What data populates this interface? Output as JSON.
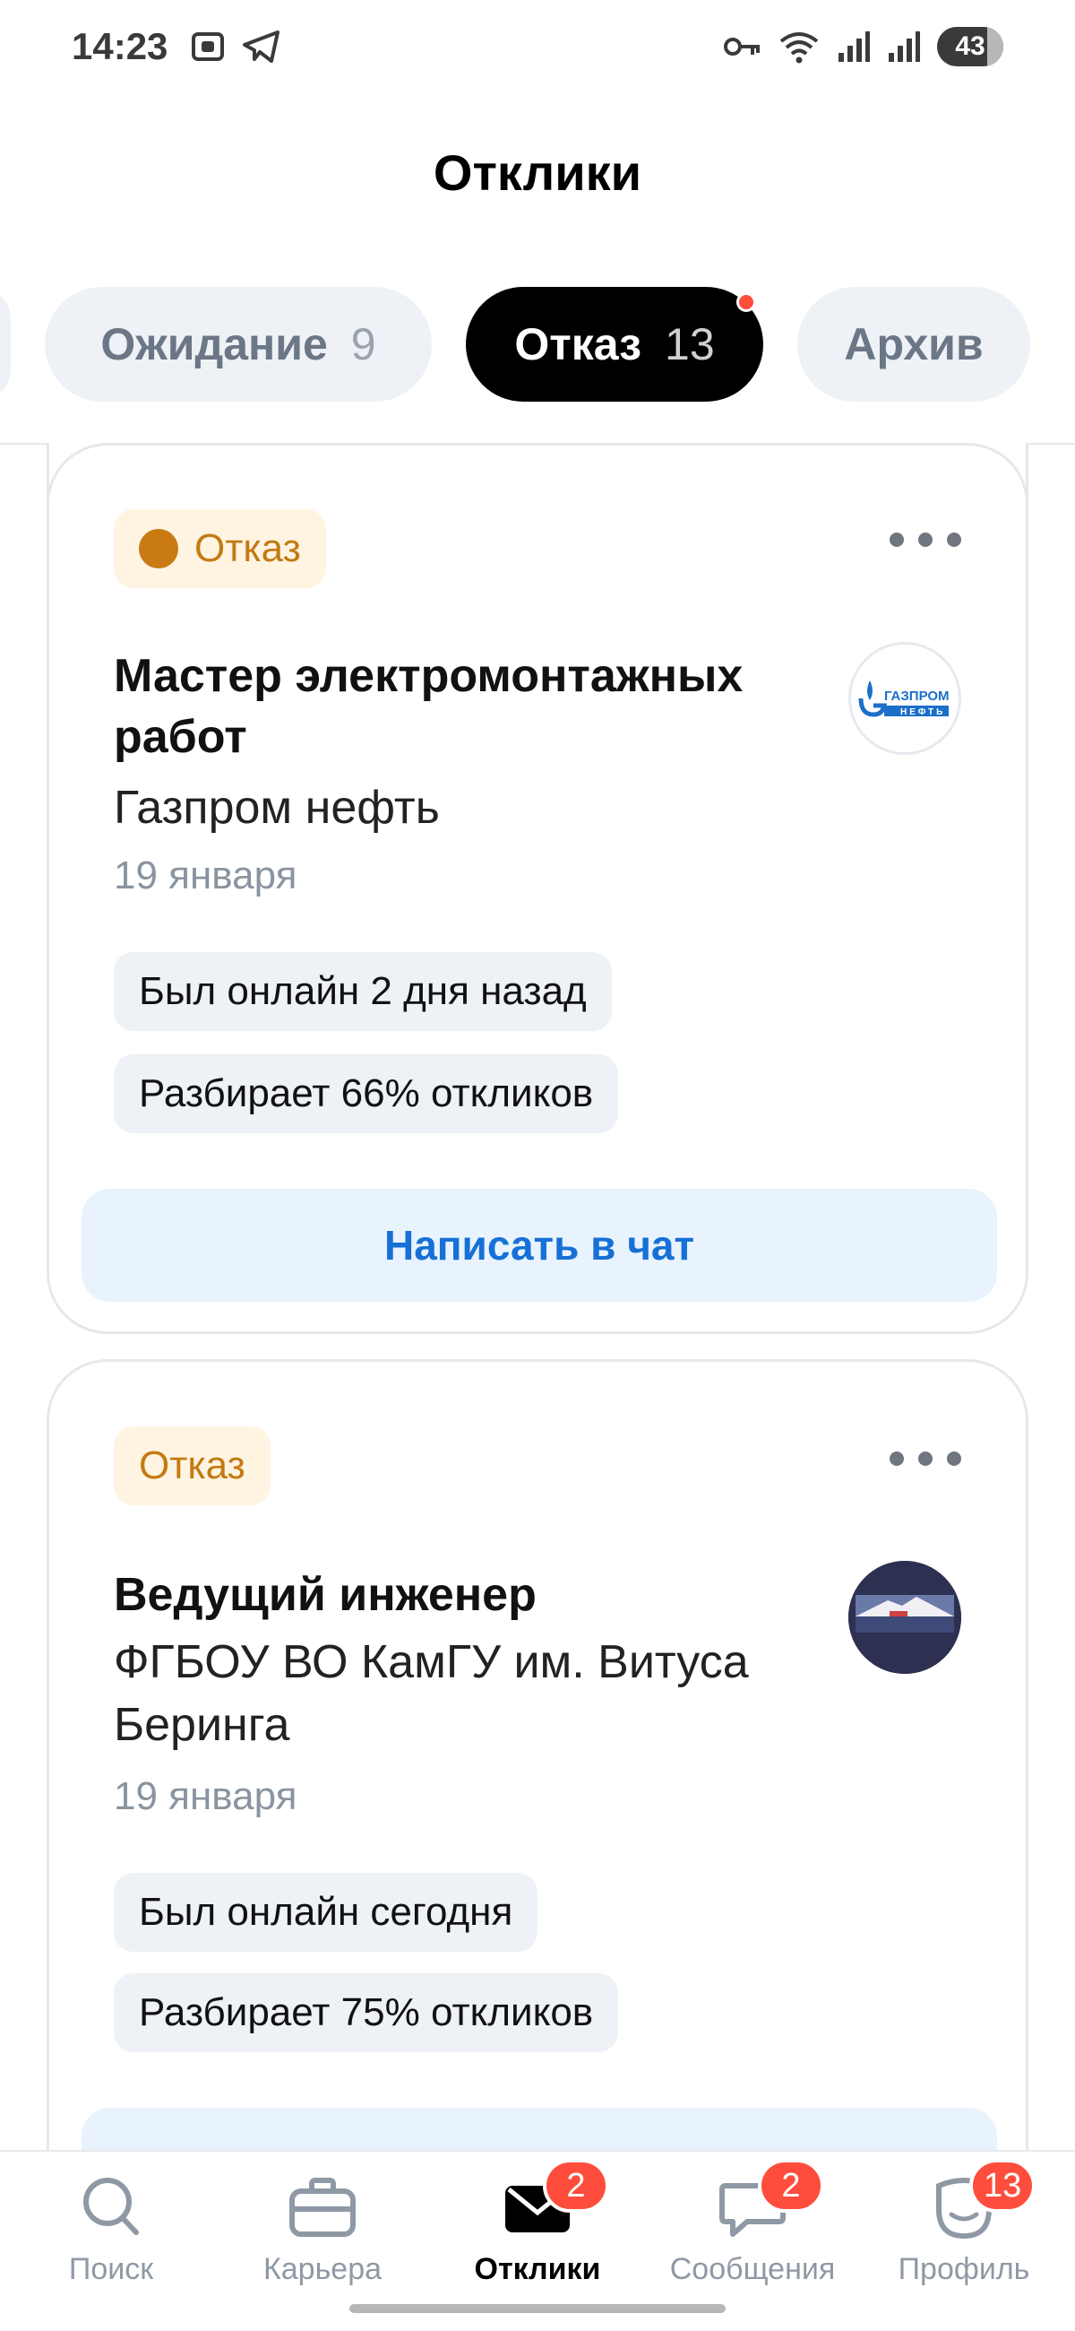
{
  "status_bar": {
    "time": "14:23",
    "battery": "43"
  },
  "header": {
    "title": "Отклики"
  },
  "tabs": [
    {
      "label": "Ожидание",
      "count": "9"
    },
    {
      "label": "Отказ",
      "count": "13"
    },
    {
      "label": "Архив"
    }
  ],
  "cards": [
    {
      "status": "Отказ",
      "title_line1": "Мастер электромонтажных",
      "title_line2": "работ",
      "company": "Газпром нефть",
      "date": "19 января",
      "online": "Был онлайн 2 дня назад",
      "response_rate": "Разбирает 66% откликов",
      "chat_button": "Написать в чат",
      "logo_text_top": "ГАЗПРОМ",
      "logo_text_bottom": "НЕФТЬ"
    },
    {
      "status": "Отказ",
      "title_line1": "Ведущий инженер",
      "company_line1": "ФГБОУ ВО КамГУ им. Витуса",
      "company_line2": "Беринга",
      "date": "19 января",
      "online": "Был онлайн сегодня",
      "response_rate": "Разбирает 75% откликов"
    }
  ],
  "bottom_nav": [
    {
      "label": "Поиск",
      "icon": "search-icon"
    },
    {
      "label": "Карьера",
      "icon": "briefcase-icon"
    },
    {
      "label": "Отклики",
      "icon": "envelope-icon",
      "badge": "2"
    },
    {
      "label": "Сообщения",
      "icon": "chat-icon",
      "badge": "2"
    },
    {
      "label": "Профиль",
      "icon": "profile-icon",
      "badge": "13"
    }
  ],
  "colors": {
    "accent_blue": "#1670d6",
    "refusal_chip_bg": "#fff4e2",
    "refusal_chip_text": "#c47a12",
    "badge_red": "#ff4d3d"
  }
}
